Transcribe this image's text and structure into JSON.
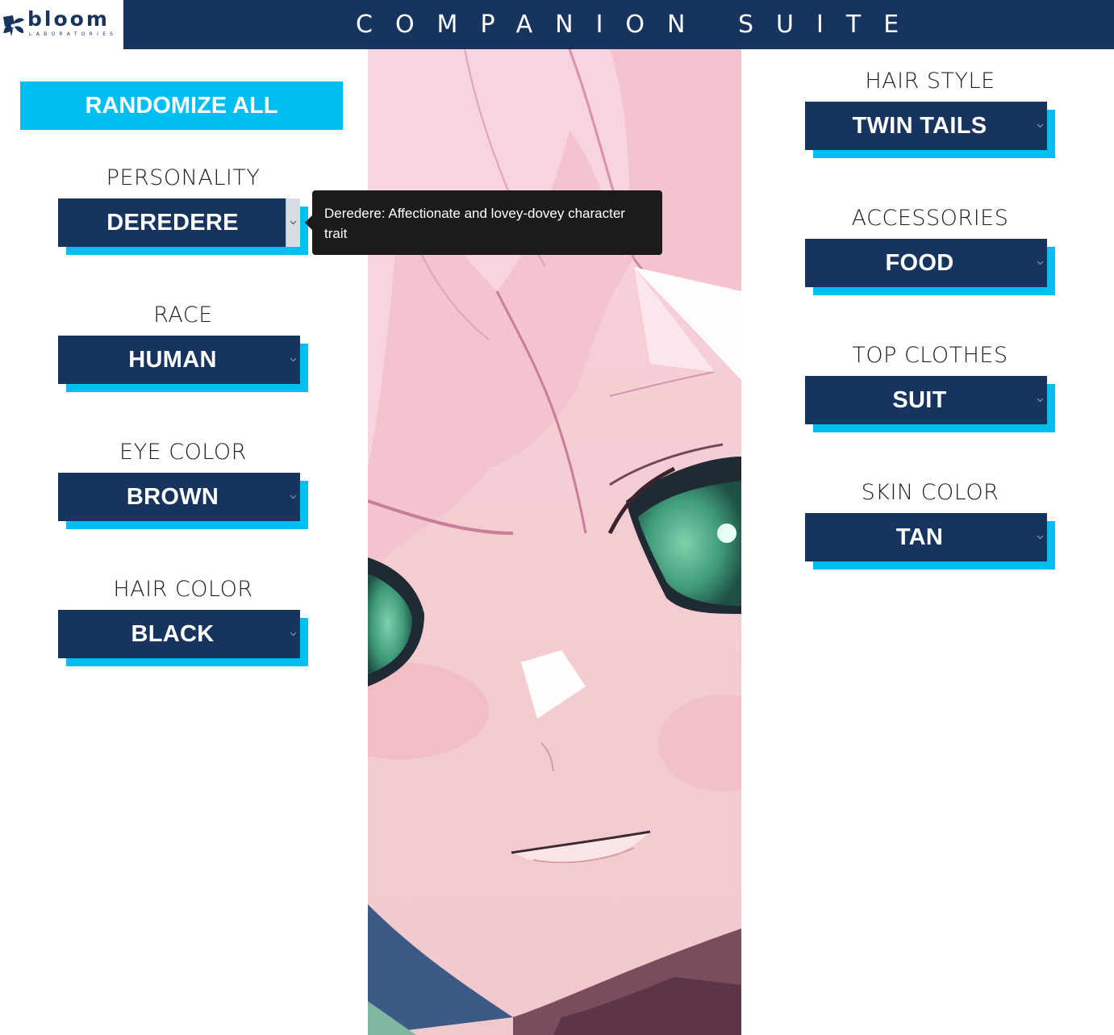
{
  "header": {
    "brand_name": "bloom",
    "brand_sub": "LABORATORIES",
    "title": "COMPANION SUITE"
  },
  "actions": {
    "randomize_label": "RANDOMIZE ALL"
  },
  "left_fields": [
    {
      "label": "PERSONALITY",
      "value": "DEREDERE"
    },
    {
      "label": "RACE",
      "value": "HUMAN"
    },
    {
      "label": "EYE COLOR",
      "value": "BROWN"
    },
    {
      "label": "HAIR COLOR",
      "value": "BLACK"
    }
  ],
  "right_fields": [
    {
      "label": "HAIR STYLE",
      "value": "TWIN TAILS"
    },
    {
      "label": "ACCESSORIES",
      "value": "FOOD"
    },
    {
      "label": "TOP CLOTHES",
      "value": "SUIT"
    },
    {
      "label": "SKIN COLOR",
      "value": "TAN"
    }
  ],
  "tooltip": {
    "text": "Deredere: Affectionate and lovey-dovey character trait"
  },
  "colors": {
    "navy": "#17345f",
    "cyan": "#00bdf2",
    "tooltip_bg": "#1c1a1a",
    "hair_pink": "#f3bccc",
    "eye_green": "#3f9a78"
  },
  "icons": {
    "caret": "chevron-down-icon",
    "logo": "bloom-flower-icon"
  }
}
